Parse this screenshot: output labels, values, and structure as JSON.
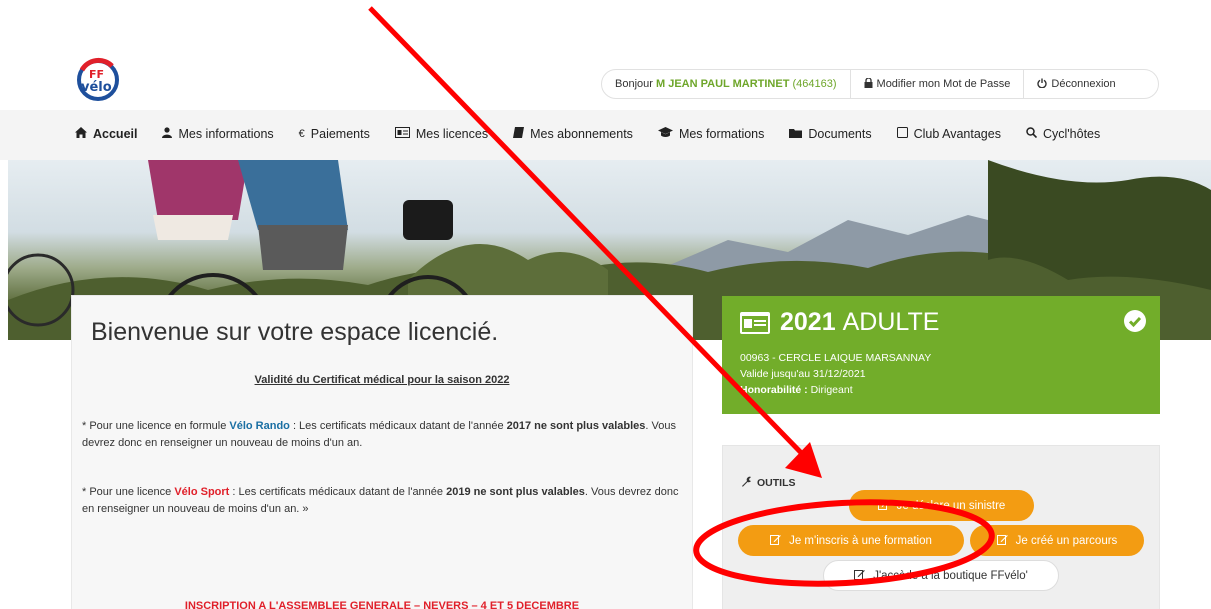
{
  "user_bar": {
    "greeting": "Bonjour",
    "user_name": "M JEAN PAUL MARTINET",
    "user_id": "(464163)",
    "change_password": "Modifier mon Mot de Passe",
    "logout": "Déconnexion"
  },
  "nav": {
    "items": [
      {
        "label": "Accueil",
        "icon": "home-icon"
      },
      {
        "label": "Mes informations",
        "icon": "user-icon"
      },
      {
        "label": "Paiements",
        "icon": "euro-icon"
      },
      {
        "label": "Mes licences",
        "icon": "id-card-icon"
      },
      {
        "label": "Mes abonnements",
        "icon": "book-icon"
      },
      {
        "label": "Mes formations",
        "icon": "graduation-cap-icon"
      },
      {
        "label": "Documents",
        "icon": "folder-icon"
      },
      {
        "label": "Club Avantages",
        "icon": "square-icon"
      },
      {
        "label": "Cycl'hôtes",
        "icon": "search-icon"
      }
    ]
  },
  "welcome": {
    "title": "Bienvenue sur votre espace licencié.",
    "certificate_title": "Validité du Certificat médical pour la saison 2022",
    "p1_a": "* Pour une licence en formule ",
    "p1_formula": "Vélo Rando",
    "p1_b": " : Les certificats médicaux datant de l'année ",
    "p1_year": "2017 ne sont plus valables",
    "p1_c": ". Vous devrez donc en renseigner un nouveau de moins d'un an.",
    "p2_a": "* Pour une licence ",
    "p2_formula": "Vélo Sport",
    "p2_b": " : Les certificats médicaux datant de l'année ",
    "p2_year": "2019 ne sont plus valables",
    "p2_c": ". Vous devrez donc en renseigner un nouveau de moins d'un an. »",
    "assembly": "INSCRIPTION A L'ASSEMBLEE GENERALE – NEVERS – 4 ET 5 DECEMBRE"
  },
  "license": {
    "year": "2021",
    "category": "ADULTE",
    "club": "00963 - CERCLE LAIQUE MARSANNAY",
    "validity": "Valide jusqu'au 31/12/2021",
    "honor_label": "Honorabilité :",
    "honor_value": "Dirigeant"
  },
  "tools": {
    "label": "OUTILS",
    "declare": "Je déclare un sinistre",
    "training": "Je m'inscris à une formation",
    "route": "Je créé un parcours",
    "shop": "J'accède à la boutique FFvélo'"
  },
  "colors": {
    "brand_green": "#72ad2a",
    "button_orange": "#f39c12",
    "annotation_red": "#ff0000",
    "alert_red": "#e0202a",
    "link_blue": "#1a6fa3"
  }
}
